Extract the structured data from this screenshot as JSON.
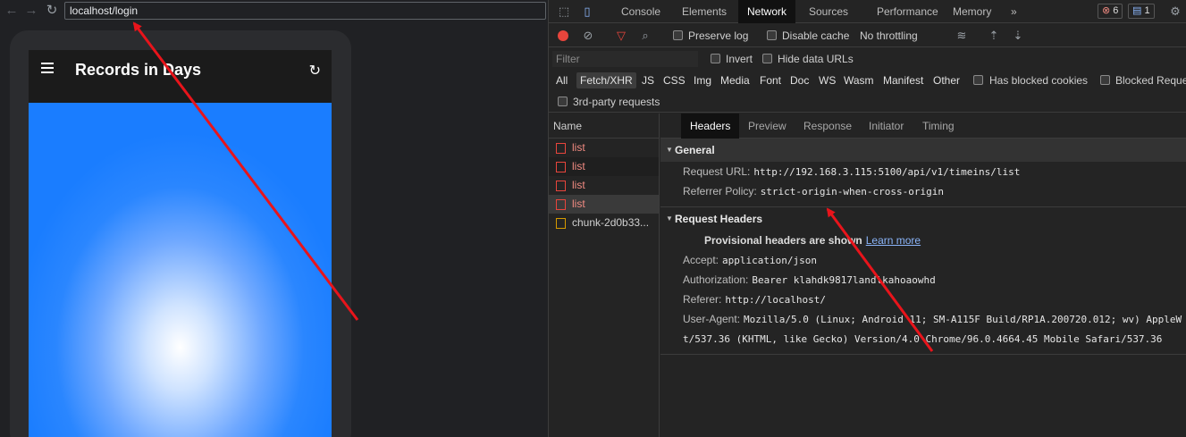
{
  "browser": {
    "url": "localhost/login",
    "app_title": "Records in Days"
  },
  "devtools": {
    "tabs": [
      "Console",
      "Elements",
      "Network",
      "Sources",
      "Performance",
      "Memory"
    ],
    "more": "»",
    "error_count": "6",
    "message_count": "1",
    "toolbar": {
      "preserve_log": "Preserve log",
      "disable_cache": "Disable cache",
      "throttling": "No throttling"
    },
    "filter": {
      "placeholder": "Filter",
      "invert": "Invert",
      "hide_data_urls": "Hide data URLs"
    },
    "type_filters": [
      "All",
      "Fetch/XHR",
      "JS",
      "CSS",
      "Img",
      "Media",
      "Font",
      "Doc",
      "WS",
      "Wasm",
      "Manifest",
      "Other"
    ],
    "has_blocked_cookies": "Has blocked cookies",
    "blocked_requests": "Blocked Reque",
    "third_party": "3rd-party requests",
    "request_list": {
      "header": "Name",
      "items": [
        "list",
        "list",
        "list",
        "list",
        "chunk-2d0b33..."
      ]
    },
    "detail_tabs": [
      "Headers",
      "Preview",
      "Response",
      "Initiator",
      "Timing"
    ],
    "general": {
      "title": "General",
      "request_url_key": "Request URL:",
      "request_url": "http://192.168.3.115:5100/api/v1/timeins/list",
      "referrer_policy_key": "Referrer Policy:",
      "referrer_policy": "strict-origin-when-cross-origin"
    },
    "request_headers": {
      "title": "Request Headers",
      "provisional": "Provisional headers are shown",
      "learn_more": "Learn more",
      "accept_key": "Accept:",
      "accept": "application/json",
      "authorization_key": "Authorization:",
      "authorization": "Bearer klahdk9817landlkahoaowhd",
      "referer_key": "Referer:",
      "referer": "http://localhost/",
      "user_agent_key": "User-Agent:",
      "user_agent_1": "Mozilla/5.0 (Linux; Android 11; SM-A115F Build/RP1A.200720.012; wv) AppleW",
      "user_agent_2": "t/537.36 (KHTML, like Gecko) Version/4.0 Chrome/96.0.4664.45 Mobile Safari/537.36"
    }
  },
  "colors": {
    "annotation_arrow": "#e8141b",
    "record_button": "#e8453c",
    "link": "#8ab4f8"
  }
}
